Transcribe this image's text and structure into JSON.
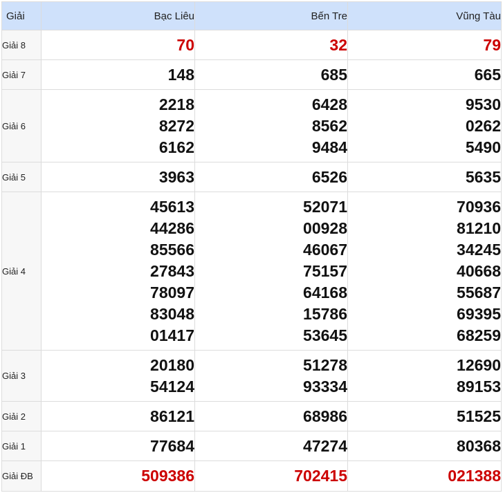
{
  "header": {
    "prize": "Giải",
    "provinces": [
      "Bạc Liêu",
      "Bến Tre",
      "Vũng Tàu"
    ]
  },
  "colors": {
    "special_number": "#cc0000",
    "header_bg": "#cfe1fb"
  },
  "rows": [
    {
      "label": "Giải 8",
      "red": true,
      "cols": [
        [
          "70"
        ],
        [
          "32"
        ],
        [
          "79"
        ]
      ]
    },
    {
      "label": "Giải 7",
      "red": false,
      "cols": [
        [
          "148"
        ],
        [
          "685"
        ],
        [
          "665"
        ]
      ]
    },
    {
      "label": "Giải 6",
      "red": false,
      "cols": [
        [
          "2218",
          "8272",
          "6162"
        ],
        [
          "6428",
          "8562",
          "9484"
        ],
        [
          "9530",
          "0262",
          "5490"
        ]
      ]
    },
    {
      "label": "Giải 5",
      "red": false,
      "cols": [
        [
          "3963"
        ],
        [
          "6526"
        ],
        [
          "5635"
        ]
      ]
    },
    {
      "label": "Giải 4",
      "red": false,
      "cols": [
        [
          "45613",
          "44286",
          "85566",
          "27843",
          "78097",
          "83048",
          "01417"
        ],
        [
          "52071",
          "00928",
          "46067",
          "75157",
          "64168",
          "15786",
          "53645"
        ],
        [
          "70936",
          "81210",
          "34245",
          "40668",
          "55687",
          "69395",
          "68259"
        ]
      ]
    },
    {
      "label": "Giải 3",
      "red": false,
      "cols": [
        [
          "20180",
          "54124"
        ],
        [
          "51278",
          "93334"
        ],
        [
          "12690",
          "89153"
        ]
      ]
    },
    {
      "label": "Giải 2",
      "red": false,
      "cols": [
        [
          "86121"
        ],
        [
          "68986"
        ],
        [
          "51525"
        ]
      ]
    },
    {
      "label": "Giải 1",
      "red": false,
      "cols": [
        [
          "77684"
        ],
        [
          "47274"
        ],
        [
          "80368"
        ]
      ]
    },
    {
      "label": "Giải ĐB",
      "red": true,
      "cols": [
        [
          "509386"
        ],
        [
          "702415"
        ],
        [
          "021388"
        ]
      ]
    }
  ]
}
